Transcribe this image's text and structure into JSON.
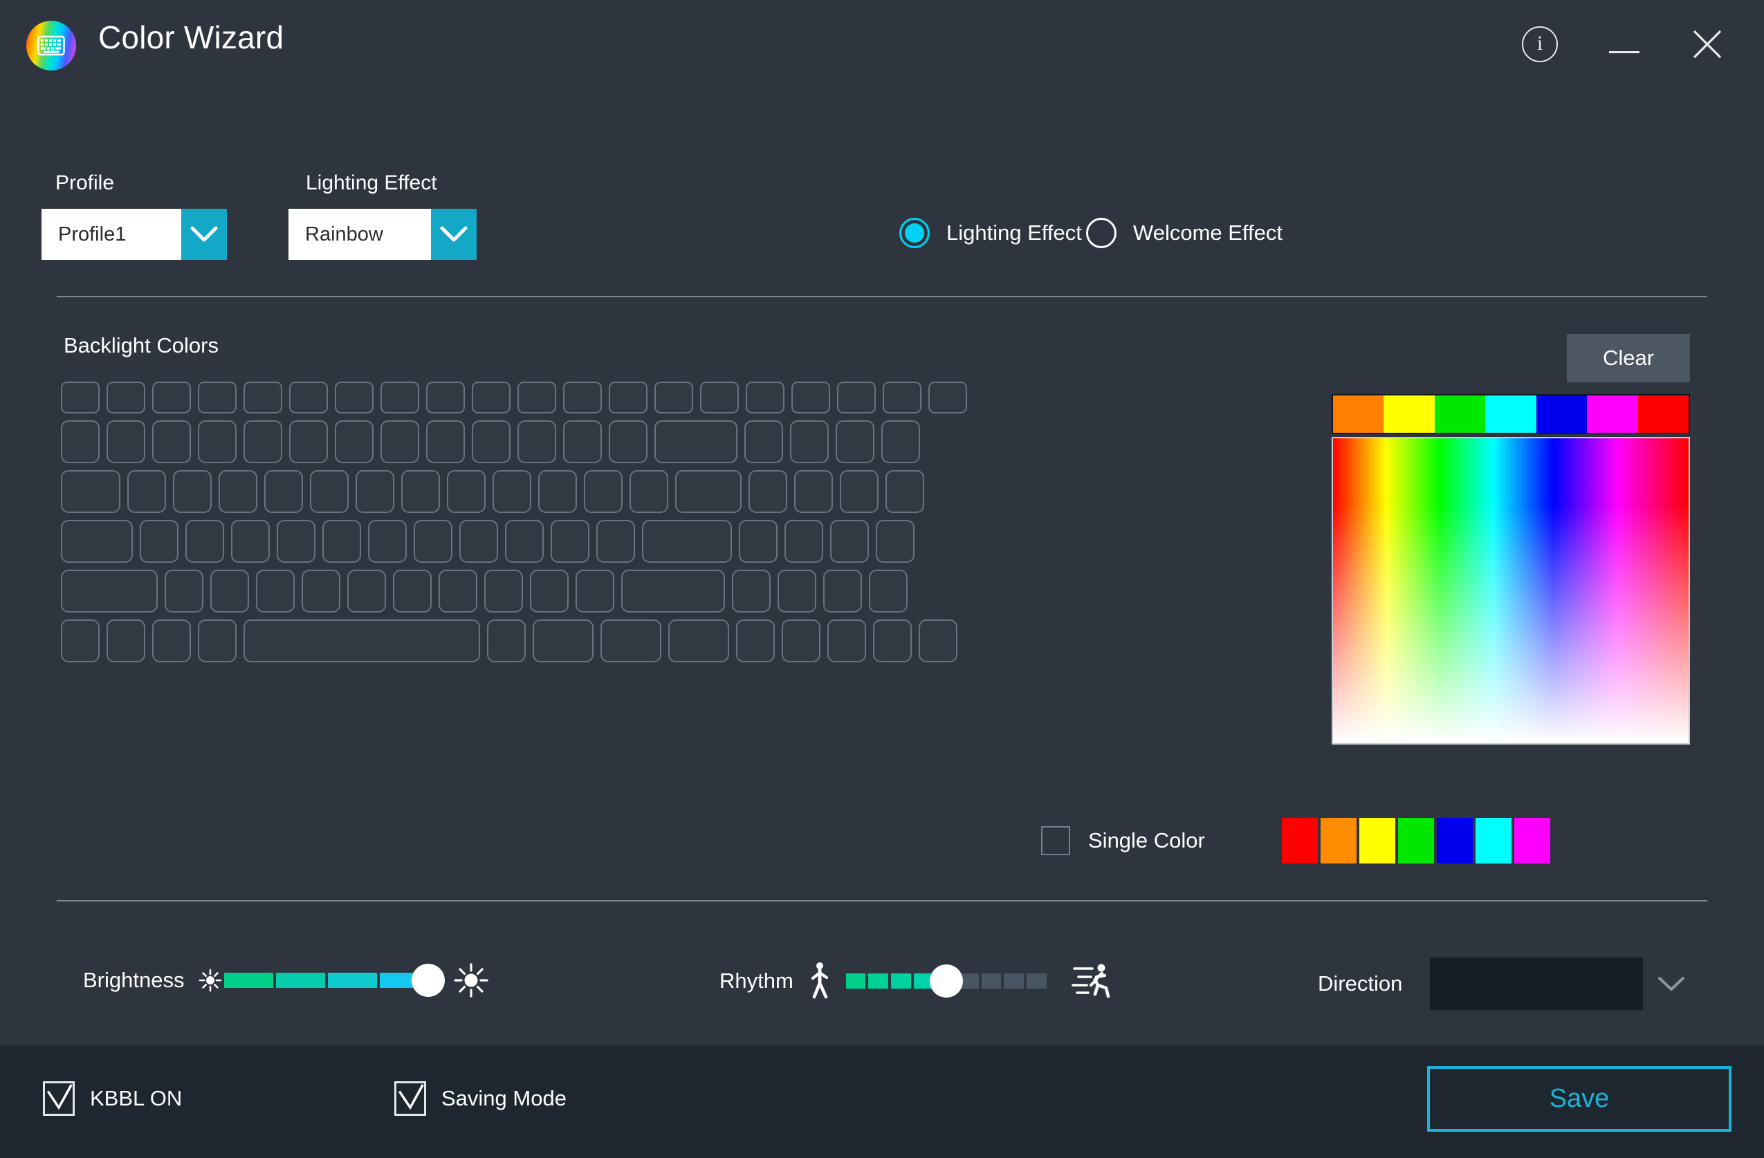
{
  "window": {
    "title": "Color Wizard",
    "icon": "keyboard-rainbow-icon",
    "controls": {
      "info": "i",
      "minimize": "minimize-icon",
      "close": "×"
    }
  },
  "top": {
    "profile": {
      "label": "Profile",
      "value": "Profile1",
      "chevron": "chevron-down-icon"
    },
    "lighting_effect": {
      "label": "Lighting Effect",
      "value": "Rainbow",
      "chevron": "chevron-down-icon"
    },
    "mode_radios": [
      {
        "label": "Lighting Effect",
        "selected": true
      },
      {
        "label": "Welcome Effect",
        "selected": false
      }
    ]
  },
  "backlight": {
    "label": "Backlight Colors",
    "clear_label": "Clear",
    "keyboard_rows": [
      [
        56,
        56,
        56,
        56,
        56,
        56,
        56,
        56,
        56,
        56,
        56,
        56,
        56,
        56,
        56,
        56,
        56,
        56,
        56,
        56
      ],
      [
        56,
        56,
        56,
        56,
        56,
        56,
        56,
        56,
        56,
        56,
        56,
        56,
        56,
        120,
        56,
        56,
        56,
        56
      ],
      [
        86,
        56,
        56,
        56,
        56,
        56,
        56,
        56,
        56,
        56,
        56,
        56,
        56,
        96,
        56,
        56,
        56,
        56
      ],
      [
        104,
        56,
        56,
        56,
        56,
        56,
        56,
        56,
        56,
        56,
        56,
        56,
        130,
        56,
        56,
        56,
        56
      ],
      [
        140,
        56,
        56,
        56,
        56,
        56,
        56,
        56,
        56,
        56,
        56,
        150,
        56,
        56,
        56,
        56
      ],
      [
        56,
        56,
        56,
        56,
        342,
        56,
        88,
        88,
        88,
        56,
        56,
        56,
        56,
        56
      ]
    ]
  },
  "picker": {
    "hue_strip": [
      "#ff7f00",
      "#ffff00",
      "#00e800",
      "#00ffff",
      "#0000ee",
      "#ff00ff",
      "#ff0000"
    ],
    "gradient": "hue-to-white-gradient"
  },
  "single_color": {
    "label": "Single Color",
    "checked": false
  },
  "swatches": [
    "#ff0000",
    "#ff8c00",
    "#ffff00",
    "#00e800",
    "#0000ee",
    "#00ffff",
    "#ff00ff"
  ],
  "sliders": {
    "brightness": {
      "label": "Brightness",
      "icon_left": "sun-small-icon",
      "icon_right": "sun-large-icon",
      "segments": 4,
      "filled": 4,
      "value": 100,
      "fill_start": "#00d08a",
      "fill_end": "#14c8f0",
      "thumb": "slider-thumb"
    },
    "rhythm": {
      "label": "Rhythm",
      "icon_left": "walking-person-icon",
      "icon_right": "running-person-icon",
      "segments": 9,
      "filled": 5,
      "value": 50,
      "fill_start": "#00d08a",
      "fill_end": "#00d2b4",
      "empty_color": "#4a5563",
      "thumb": "slider-thumb"
    }
  },
  "direction": {
    "label": "Direction",
    "value": "",
    "chevron": "chevron-down-icon"
  },
  "bottom": {
    "kbbl": {
      "label": "KBBL ON",
      "checked": true
    },
    "saving_mode": {
      "label": "Saving Mode",
      "checked": true
    },
    "save_label": "Save",
    "accent": "#19b4d8"
  }
}
